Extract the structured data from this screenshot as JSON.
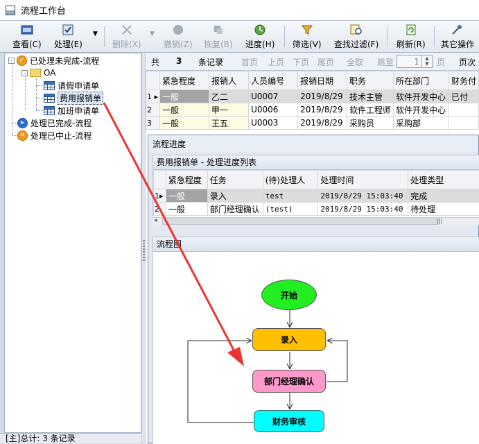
{
  "window": {
    "title": "流程工作台"
  },
  "toolbar": {
    "items": [
      {
        "label": "查看(C)",
        "icon": "view-icon",
        "enabled": true
      },
      {
        "label": "处理(E)",
        "icon": "process-icon",
        "enabled": true
      },
      {
        "label": "删除(X)",
        "icon": "delete-icon",
        "enabled": false
      },
      {
        "label": "撤销(Z)",
        "icon": "undo-icon",
        "enabled": false
      },
      {
        "label": "恢复(B)",
        "icon": "restore-icon",
        "enabled": false
      },
      {
        "label": "进度(H)",
        "icon": "progress-icon",
        "enabled": true
      },
      {
        "label": "筛选(V)",
        "icon": "filter-icon",
        "enabled": true
      },
      {
        "label": "查找过滤(F)",
        "icon": "find-filter-icon",
        "enabled": true
      },
      {
        "label": "刷新(R)",
        "icon": "refresh-icon",
        "enabled": true
      },
      {
        "label": "其它操作",
        "icon": "other-ops-icon",
        "enabled": true
      }
    ]
  },
  "tree": {
    "nodes": [
      {
        "label": "已处理未完成-流程",
        "expander": "-"
      },
      {
        "label": "OA",
        "expander": "-"
      },
      {
        "label": "请假申请单"
      },
      {
        "label": "费用报销单",
        "selected": true
      },
      {
        "label": "加班申请单"
      },
      {
        "label": "处理已完成-流程"
      },
      {
        "label": "处理已中止-流程"
      }
    ]
  },
  "status": {
    "text": "[主]总计: 3 条记录"
  },
  "navbar": {
    "total_prefix": "共",
    "total_count": "3",
    "total_suffix": "条记录",
    "first": "首页",
    "prev": "上页",
    "next": "下页",
    "last": "尾页",
    "all": "全取",
    "jump": "跳至",
    "page_value": "1",
    "page_unit": "页",
    "page_count_label": "页次"
  },
  "main_grid": {
    "columns": [
      "紧急程度",
      "报销人",
      "人员编号",
      "报销日期",
      "职务",
      "所在部门",
      "财务付"
    ],
    "rows": [
      {
        "num": "1",
        "cells": [
          "一般",
          "乙二",
          "U0007",
          "2019/8/29",
          "技术主管",
          "软件开发中心",
          "已付"
        ]
      },
      {
        "num": "2",
        "cells": [
          "一般",
          "甲一",
          "U0006",
          "2019/8/29",
          "软件工程师",
          "软件开发中心",
          ""
        ]
      },
      {
        "num": "3",
        "cells": [
          "一般",
          "王五",
          "U0003",
          "2019/8/29",
          "采购员",
          "采购部",
          ""
        ]
      }
    ]
  },
  "dialog": {
    "title": "流程进度",
    "list_header": "费用报销单 - 处理进度列表",
    "columns": [
      "紧急程度",
      "任务",
      "(待)处理人",
      "处理时间",
      "处理类型"
    ],
    "rows": [
      {
        "num": "1",
        "cells": [
          "一般",
          "录入",
          "test",
          "2019/8/29 15:03:40",
          "完成"
        ]
      },
      {
        "num": "2",
        "cells": [
          "一般",
          "部门经理确认",
          "(test)",
          "2019/8/29 15:03:40",
          "待处理"
        ]
      }
    ],
    "flow_header": "流程图",
    "flow": {
      "start": "开始",
      "entry": "录入",
      "confirm": "部门经理确认",
      "finance": "财务审核"
    }
  },
  "colors": {
    "start_node": "#22ee22",
    "entry_node": "#ffc000",
    "confirm_node": "#ff99cc",
    "finance_node": "#00ffff",
    "annotation_arrow": "#ee3333"
  }
}
